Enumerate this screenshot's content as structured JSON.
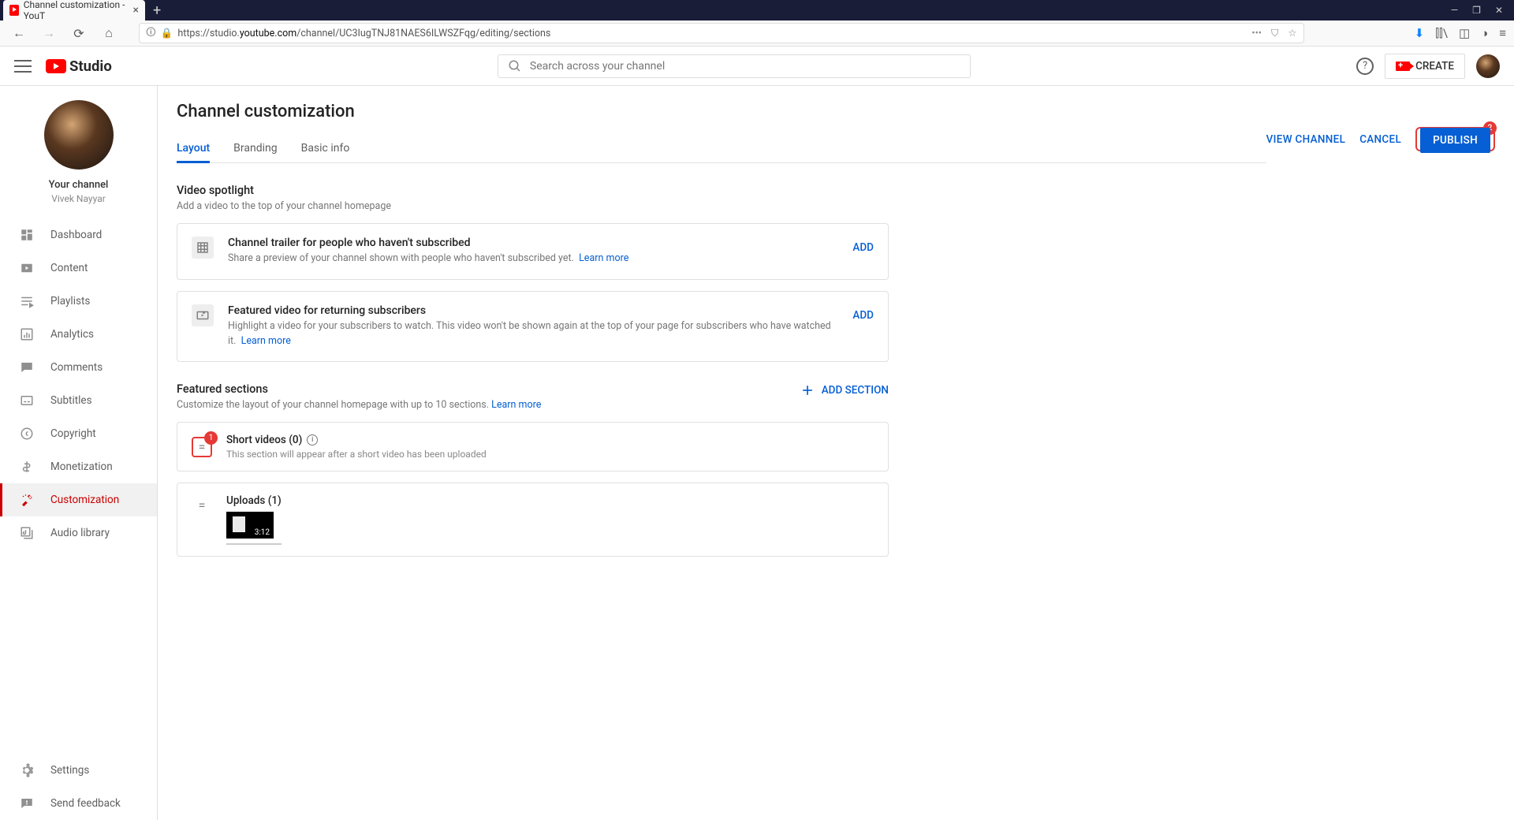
{
  "browser": {
    "tab_title": "Channel customization - YouT",
    "url_prefix": "https://studio.",
    "url_bold": "youtube.com",
    "url_suffix": "/channel/UC3IugTNJ81NAES6ILWSZFqg/editing/sections"
  },
  "topbar": {
    "logo_text": "Studio",
    "search_placeholder": "Search across your channel",
    "create_label": "CREATE"
  },
  "sidebar": {
    "channel_label": "Your channel",
    "channel_name": "Vivek Nayyar",
    "items": [
      {
        "label": "Dashboard"
      },
      {
        "label": "Content"
      },
      {
        "label": "Playlists"
      },
      {
        "label": "Analytics"
      },
      {
        "label": "Comments"
      },
      {
        "label": "Subtitles"
      },
      {
        "label": "Copyright"
      },
      {
        "label": "Monetization"
      },
      {
        "label": "Customization"
      },
      {
        "label": "Audio library"
      }
    ],
    "footer": [
      {
        "label": "Settings"
      },
      {
        "label": "Send feedback"
      }
    ]
  },
  "page": {
    "title": "Channel customization",
    "tabs": [
      "Layout",
      "Branding",
      "Basic info"
    ],
    "actions": {
      "view": "VIEW CHANNEL",
      "cancel": "CANCEL",
      "publish": "PUBLISH",
      "publish_badge": "2"
    }
  },
  "spotlight": {
    "title": "Video spotlight",
    "subtitle": "Add a video to the top of your channel homepage",
    "trailer": {
      "title": "Channel trailer for people who haven't subscribed",
      "desc": "Share a preview of your channel shown with people who haven't subscribed yet.",
      "learn": "Learn more",
      "action": "ADD"
    },
    "featured": {
      "title": "Featured video for returning subscribers",
      "desc": "Highlight a video for your subscribers to watch. This video won't be shown again at the top of your page for subscribers who have watched it.",
      "learn": "Learn more",
      "action": "ADD"
    }
  },
  "featured_sections": {
    "title": "Featured sections",
    "subtitle": "Customize the layout of your channel homepage with up to 10 sections.",
    "learn": "Learn more",
    "add_label": "ADD SECTION",
    "short": {
      "title": "Short videos (0)",
      "desc": "This section will appear after a short video has been uploaded",
      "badge": "1"
    },
    "uploads": {
      "title": "Uploads (1)",
      "duration": "3:12"
    }
  }
}
